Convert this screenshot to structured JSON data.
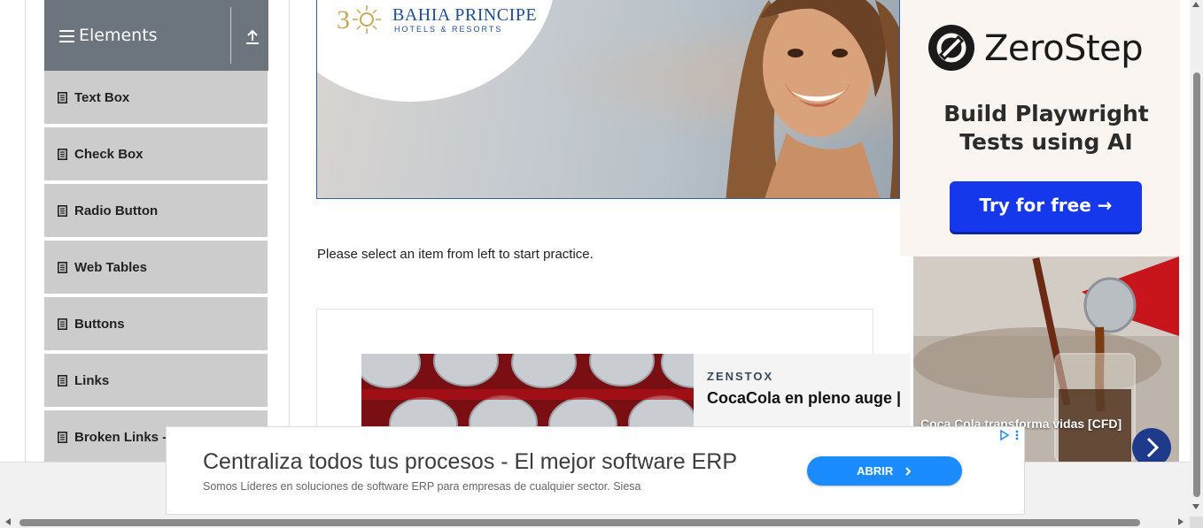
{
  "sidebar": {
    "group_title": "Elements",
    "items": [
      {
        "label": "Text Box"
      },
      {
        "label": "Check Box"
      },
      {
        "label": "Radio Button"
      },
      {
        "label": "Web Tables"
      },
      {
        "label": "Buttons"
      },
      {
        "label": "Links"
      },
      {
        "label": "Broken Links -"
      }
    ]
  },
  "hero_ad": {
    "brand": "BAHIA PRINCIPE",
    "brand_sub": "HOTELS & RESORTS"
  },
  "main": {
    "practice_text": "Please select an item from left to start practice."
  },
  "native_ad": {
    "source": "ZENSTOX",
    "headline": "CocaCola en pleno auge |"
  },
  "zerostep_ad": {
    "logo_text": "ZeroStep",
    "tagline": "Build Playwright\nTests using AI",
    "cta": "Try for free →",
    "accent": "#1638ec"
  },
  "coke_ad": {
    "caption": "Coca Cola transforma vidas [CFD]"
  },
  "bottom_banner": {
    "headline": "Centraliza todos tus procesos - El mejor software ERP",
    "description": "Somos Líderes en soluciones de software ERP para empresas de cualquier sector. Siesa",
    "cta": "ABRIR",
    "accent": "#1a8cff"
  },
  "colors": {
    "sidebar_header": "#6c757d",
    "sidebar_item": "#cccccc"
  }
}
